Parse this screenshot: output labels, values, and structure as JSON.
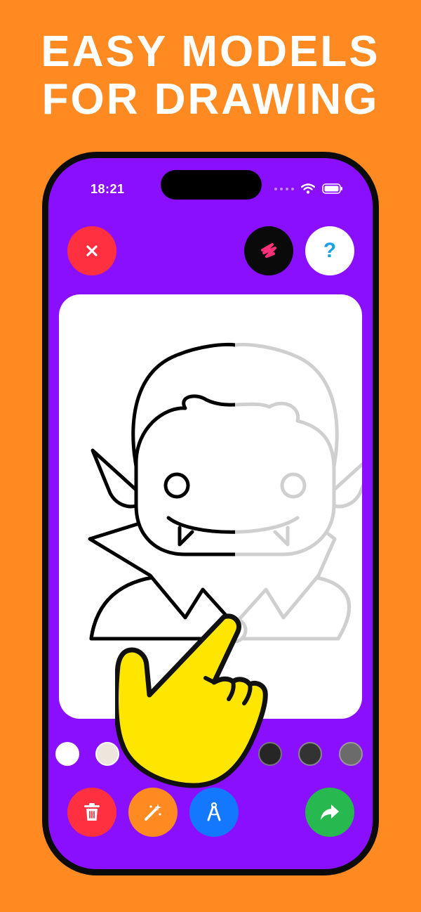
{
  "headline": {
    "line1": "EASY MODELS",
    "line2": "FOR DRAWING"
  },
  "status_bar": {
    "time": "18:21",
    "icons": [
      "signal-dots-icon",
      "wifi-icon",
      "battery-icon"
    ]
  },
  "top_bar": {
    "close_icon": "close-icon",
    "brush_icon": "brush-icon",
    "help_label": "?"
  },
  "canvas": {
    "drawing": "vampire-outline",
    "progress": 0.5
  },
  "palette": {
    "colors": [
      "#ffffff",
      "#ece6dc",
      "#b9b3ab",
      "#8e8a85",
      "#1c1c1c",
      "#262626",
      "#333333",
      "#4a4a4a",
      "#6b6b6b"
    ]
  },
  "toolbar": {
    "buttons": [
      "trash-icon",
      "magic-wand-icon",
      "compass-icon",
      "share-arrow-icon"
    ]
  },
  "colors": {
    "background": "#FF8A22",
    "screen": "#8A0FFF",
    "close": "#FF3040",
    "help_mark": "#1AA0E6",
    "brush_mark": "#FF2F7A",
    "compass": "#1478FF",
    "share": "#28B850",
    "hand": "#FFE600"
  }
}
